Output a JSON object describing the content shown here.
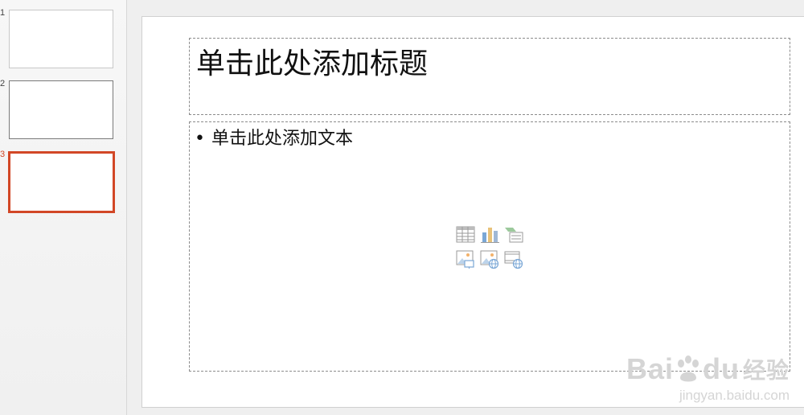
{
  "slides_panel": {
    "slides": [
      {
        "number": "1",
        "state": "normal"
      },
      {
        "number": "2",
        "state": "hover"
      },
      {
        "number": "3",
        "state": "selected"
      }
    ]
  },
  "slide": {
    "title_placeholder": "单击此处添加标题",
    "content_bullet": "•",
    "content_placeholder": "单击此处添加文本",
    "insert_icons": [
      "table-icon",
      "chart-icon",
      "smartart-icon",
      "picture-icon",
      "online-picture-icon",
      "video-icon"
    ]
  },
  "watermark": {
    "logo_text": "Bai",
    "logo_text_2": "du",
    "logo_suffix": "经验",
    "url": "jingyan.baidu.com"
  },
  "colors": {
    "accent": "#d24726",
    "placeholder_border": "#8c8c8c",
    "icon_blue": "#7aa7d6",
    "icon_green": "#9cc99c",
    "icon_orange": "#f2b26b"
  }
}
